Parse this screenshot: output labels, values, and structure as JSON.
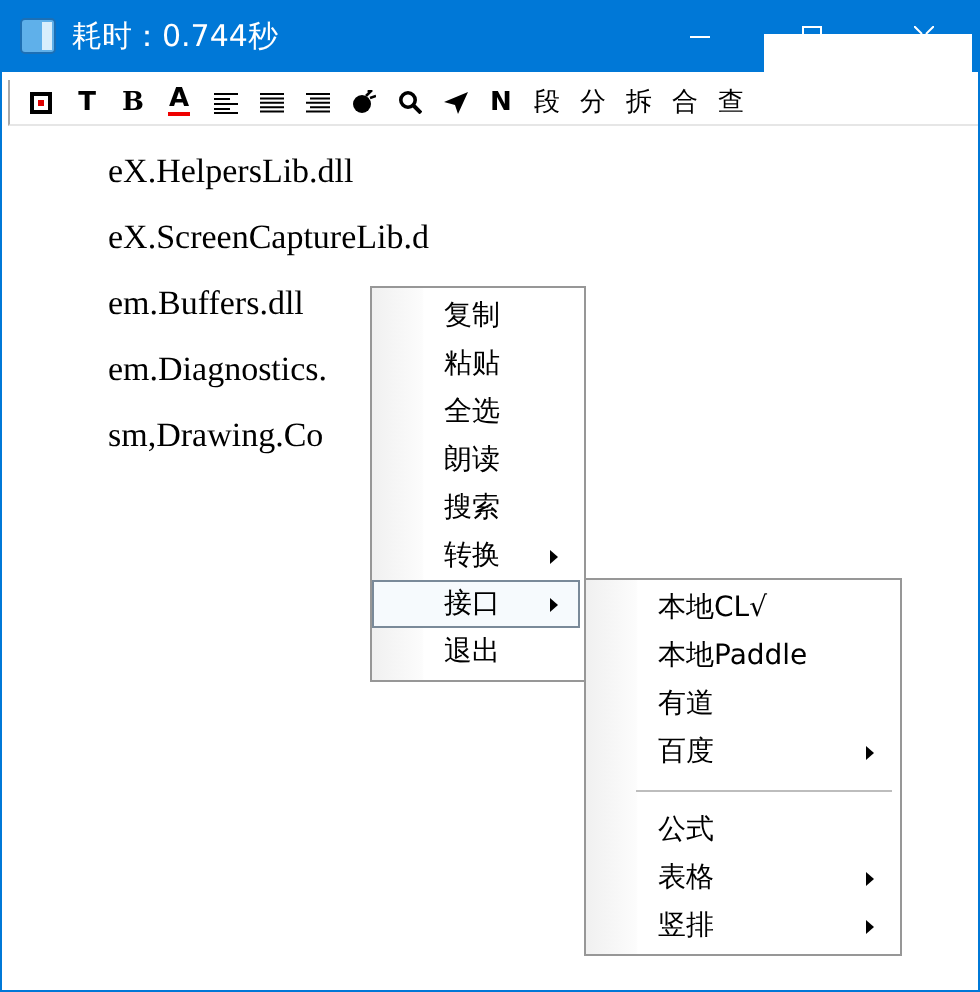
{
  "window": {
    "title": "耗时：0.744秒"
  },
  "toolbar": [
    {
      "kind": "icon"
    },
    {
      "kind": "text",
      "label": "T",
      "underline": false
    },
    {
      "kind": "text",
      "label": "B",
      "underline": false
    },
    {
      "kind": "text",
      "label": "A",
      "underline": true
    },
    {
      "kind": "icon"
    },
    {
      "kind": "icon"
    },
    {
      "kind": "icon"
    },
    {
      "kind": "icon"
    },
    {
      "kind": "icon"
    },
    {
      "kind": "icon"
    },
    {
      "kind": "text",
      "label": "N",
      "underline": false
    },
    {
      "kind": "text",
      "label": "段",
      "underline": false
    },
    {
      "kind": "text",
      "label": "分",
      "underline": false
    },
    {
      "kind": "text",
      "label": "拆",
      "underline": false
    },
    {
      "kind": "text",
      "label": "合",
      "underline": false
    },
    {
      "kind": "text",
      "label": "查",
      "underline": false
    }
  ],
  "lines": [
    "eX.HelpersLib.dll",
    "eX.ScreenCaptureLib.d",
    "em.Buffers.dll",
    "em.Diagnostics.",
    "sm,Drawing.Co"
  ],
  "context_menu": {
    "items": [
      {
        "label": "复制",
        "submenu": false,
        "selected": false
      },
      {
        "label": "粘贴",
        "submenu": false,
        "selected": false
      },
      {
        "label": "全选",
        "submenu": false,
        "selected": false
      },
      {
        "label": "朗读",
        "submenu": false,
        "selected": false
      },
      {
        "label": "搜索",
        "submenu": false,
        "selected": false
      },
      {
        "label": "转换",
        "submenu": true,
        "selected": false
      },
      {
        "label": "接口",
        "submenu": true,
        "selected": true
      },
      {
        "label": "退出",
        "submenu": false,
        "selected": false
      }
    ]
  },
  "submenu": {
    "items": [
      {
        "kind": "item",
        "label": "本地CL√",
        "submenu": false,
        "selected": false
      },
      {
        "kind": "item",
        "label": "本地Paddle",
        "submenu": false,
        "selected": false
      },
      {
        "kind": "item",
        "label": "有道",
        "submenu": false,
        "selected": false
      },
      {
        "kind": "item",
        "label": "百度",
        "submenu": true,
        "selected": false
      },
      {
        "kind": "separator"
      },
      {
        "kind": "item",
        "label": "公式",
        "submenu": false,
        "selected": false
      },
      {
        "kind": "item",
        "label": "表格",
        "submenu": true,
        "selected": false
      },
      {
        "kind": "item",
        "label": "竖排",
        "submenu": true,
        "selected": false
      }
    ]
  }
}
